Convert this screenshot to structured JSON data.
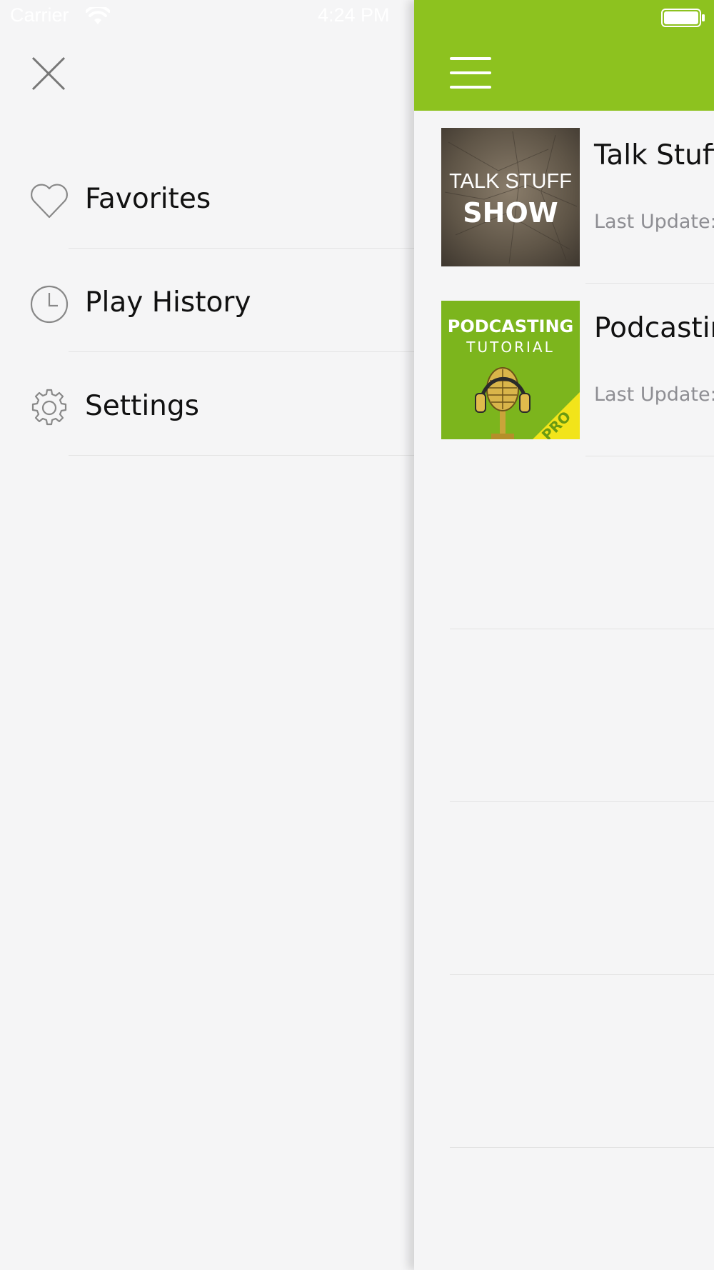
{
  "status_bar": {
    "carrier": "Carrier",
    "time": "4:24 PM",
    "wifi_icon": "wifi-icon",
    "battery_icon": "battery-icon"
  },
  "side_menu": {
    "close_icon": "close-icon",
    "items": [
      {
        "label": "Favorites",
        "icon": "heart-icon"
      },
      {
        "label": "Play History",
        "icon": "clock-icon"
      },
      {
        "label": "Settings",
        "icon": "gear-icon"
      }
    ]
  },
  "main": {
    "navbar_color": "#8dc21f",
    "menu_icon": "hamburger-icon",
    "podcasts": [
      {
        "title": "Talk Stuff",
        "subtitle": "Last Update:",
        "artwork": {
          "line1": "TALK STUFF",
          "line2": "SHOW"
        }
      },
      {
        "title": "Podcastin",
        "subtitle": "Last Update:",
        "artwork": {
          "line1": "PODCASTING",
          "line2": "TUTORIAL",
          "badge": "PRO"
        }
      }
    ]
  }
}
